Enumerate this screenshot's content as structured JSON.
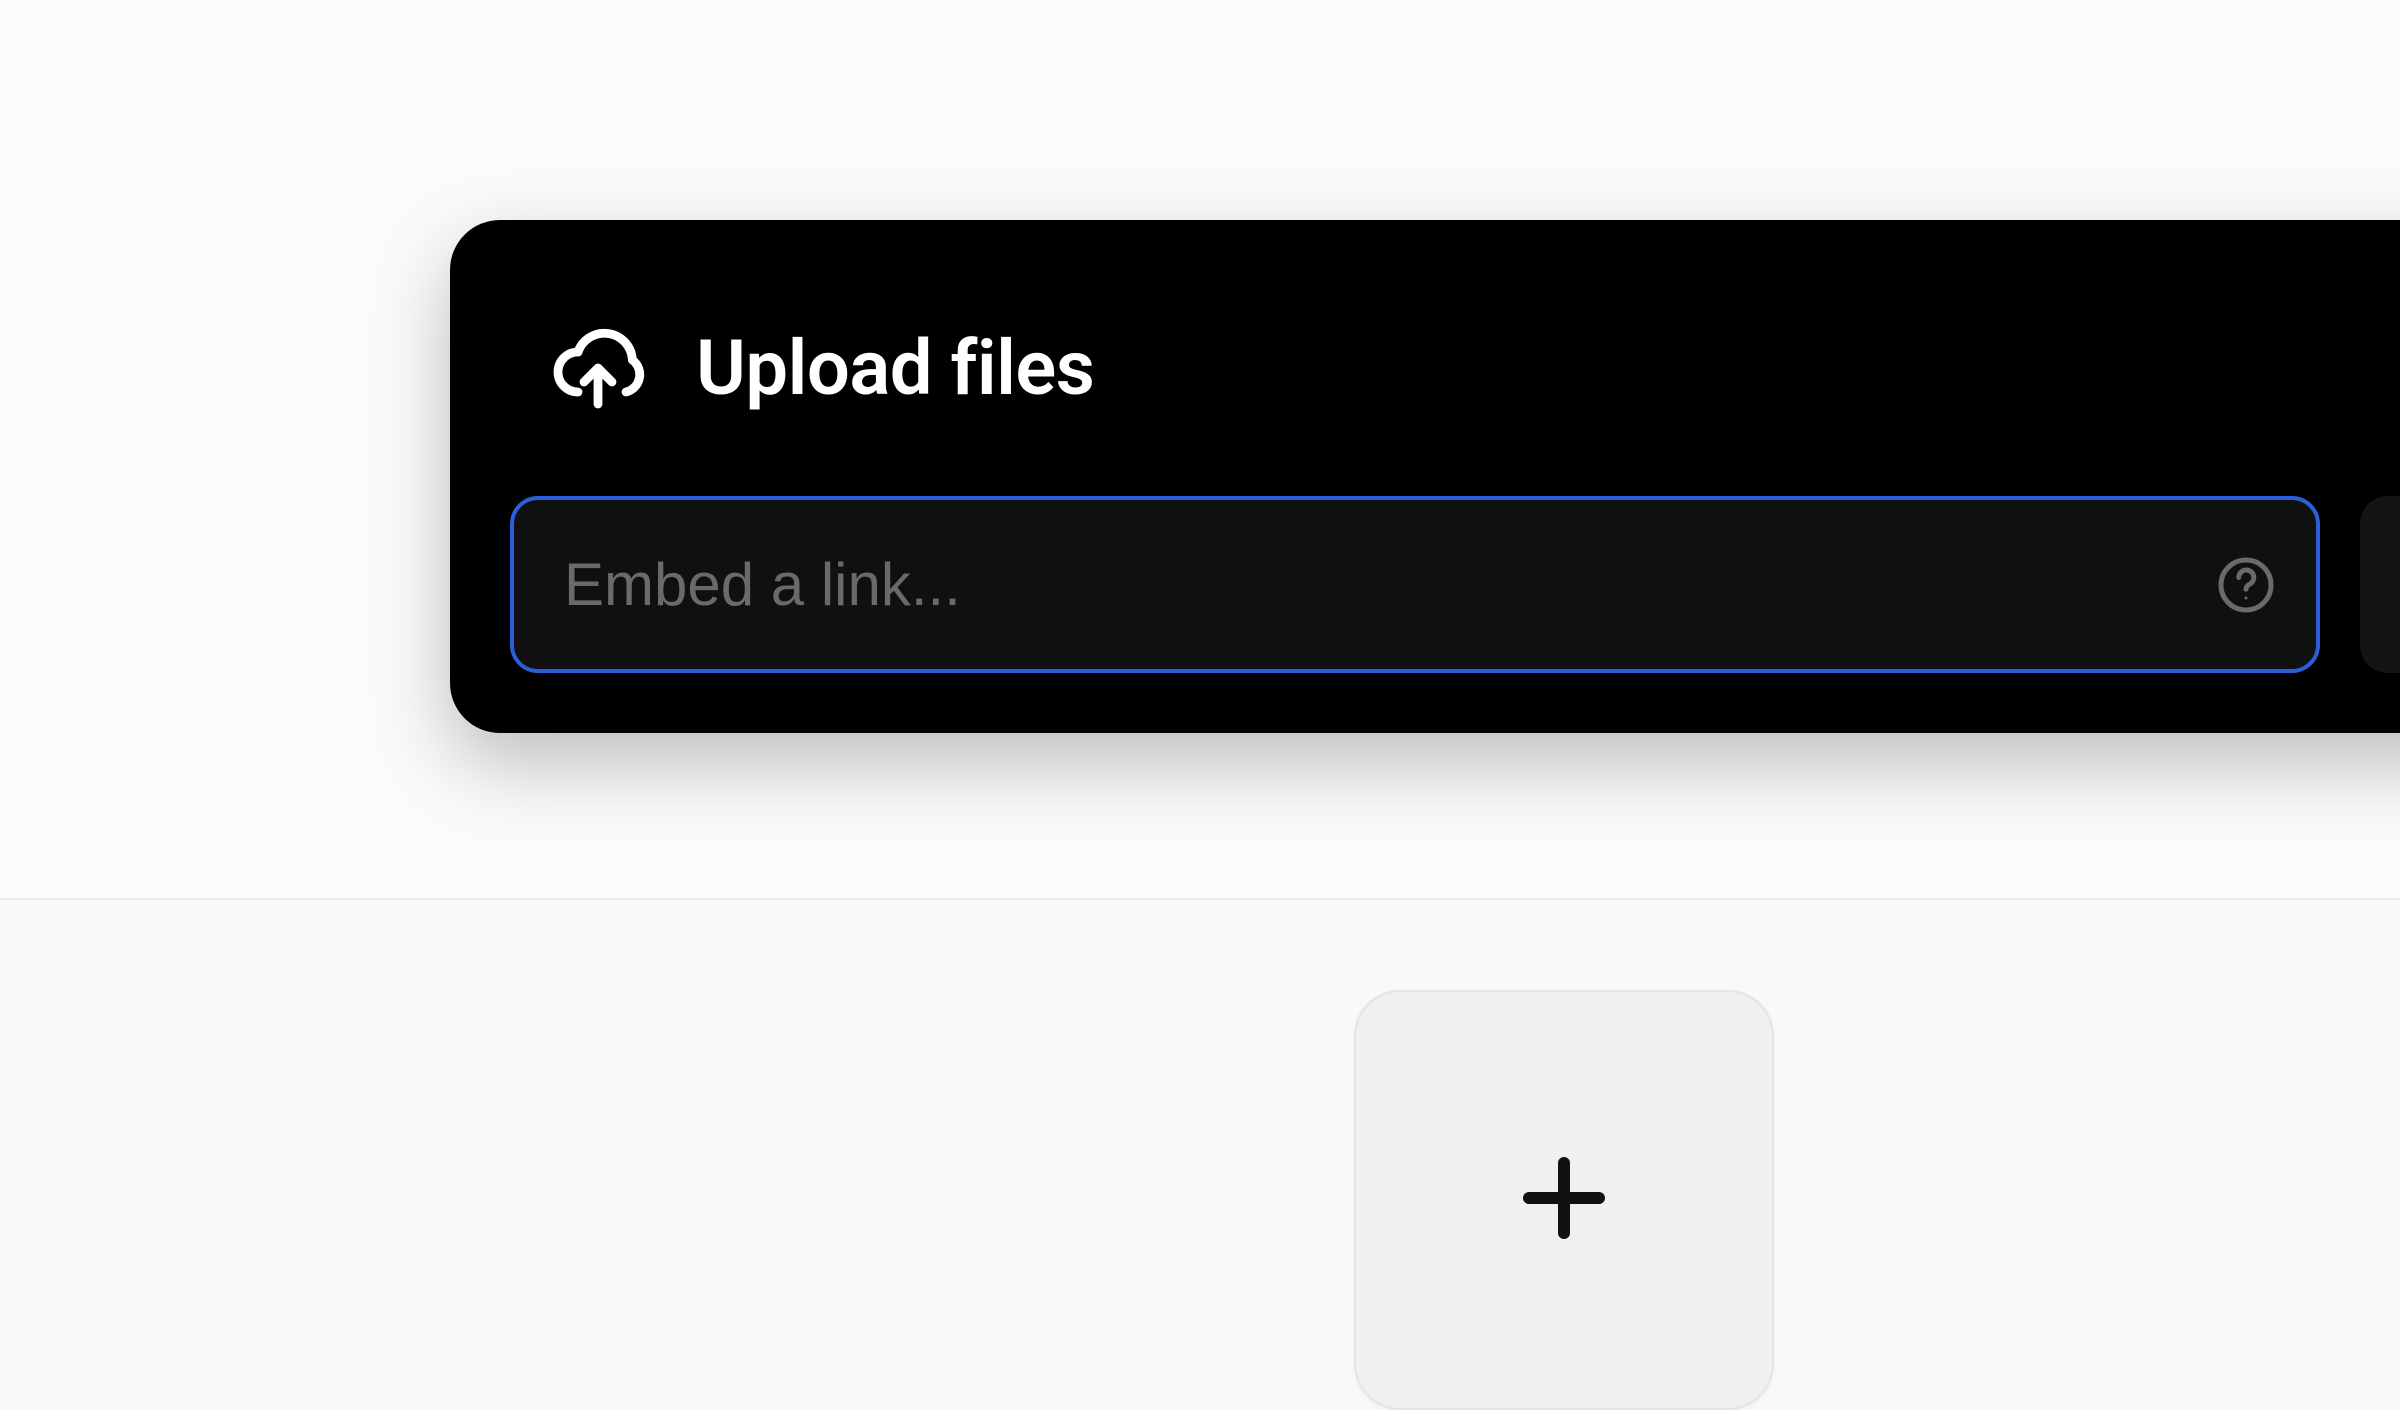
{
  "upload": {
    "title": "Upload files",
    "embed_placeholder": "Embed a link...",
    "colors": {
      "panel_bg": "#000000",
      "input_border": "#2b5fd9",
      "placeholder": "#6a6a6a",
      "page_bg": "#f9f9f9"
    }
  }
}
